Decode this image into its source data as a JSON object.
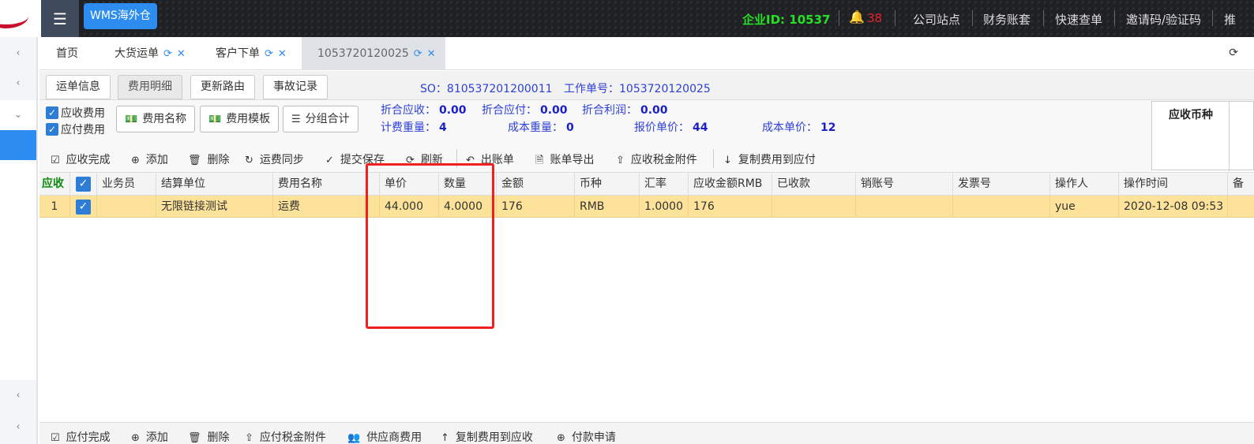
{
  "header": {
    "app_label": "WMS海外仓",
    "company_id_label": "企业ID:",
    "company_id": "10537",
    "notification_count": "38",
    "links": [
      "公司站点",
      "财务账套",
      "快速查单",
      "邀请码/验证码",
      "推"
    ]
  },
  "tabs": [
    {
      "label": "首页"
    },
    {
      "label": "大货运单"
    },
    {
      "label": "客户下单"
    },
    {
      "label": "1053720120025"
    }
  ],
  "subtabs": [
    "运单信息",
    "费用明细",
    "更新路由",
    "事故记录"
  ],
  "so_text": "SO：810537201200011",
  "work_text": "工作单号：1053720120025",
  "options": {
    "receivable_label": "应收费用",
    "payable_label": "应付费用",
    "fee_name_button": "费用名称",
    "fee_template_button": "费用模板",
    "group_total_button": "分组合计"
  },
  "summary": {
    "net_receivable_label": "折合应收：",
    "net_receivable": "0.00",
    "net_payable_label": "折合应付：",
    "net_payable": "0.00",
    "net_profit_label": "折合利润：",
    "net_profit": "0.00",
    "charge_weight_label": "计费重量：",
    "charge_weight": "4",
    "cost_weight_label": "成本重量：",
    "cost_weight": "0",
    "quote_price_label": "报价单价：",
    "quote_price": "44",
    "cost_price_label": "成本单价：",
    "cost_price": "12"
  },
  "currency_box_header": "应收币种",
  "toolbar": [
    "应收完成",
    "添加",
    "删除",
    "运费同步",
    "提交保存",
    "刷新",
    "出账单",
    "账单导出",
    "应收税金附件",
    "复制费用到应付"
  ],
  "grid": {
    "section_label": "应收",
    "columns": [
      "业务员",
      "结算单位",
      "费用名称",
      "单价",
      "数量",
      "金额",
      "币种",
      "汇率",
      "应收金额RMB",
      "已收款",
      "销账号",
      "发票号",
      "操作人",
      "操作时间",
      "备"
    ],
    "rows": [
      {
        "index": "1",
        "cells": [
          "",
          "无限链接测试",
          "运费",
          "44.000",
          "4.0000",
          "176",
          "RMB",
          "1.0000",
          "176",
          "",
          "",
          "",
          "yue",
          "2020-12-08 09:53",
          ""
        ]
      }
    ]
  },
  "bottom_toolbar": [
    "应付完成",
    "添加",
    "删除",
    "应付税金附件",
    "供应商费用",
    "复制费用到应收",
    "付款申请"
  ]
}
